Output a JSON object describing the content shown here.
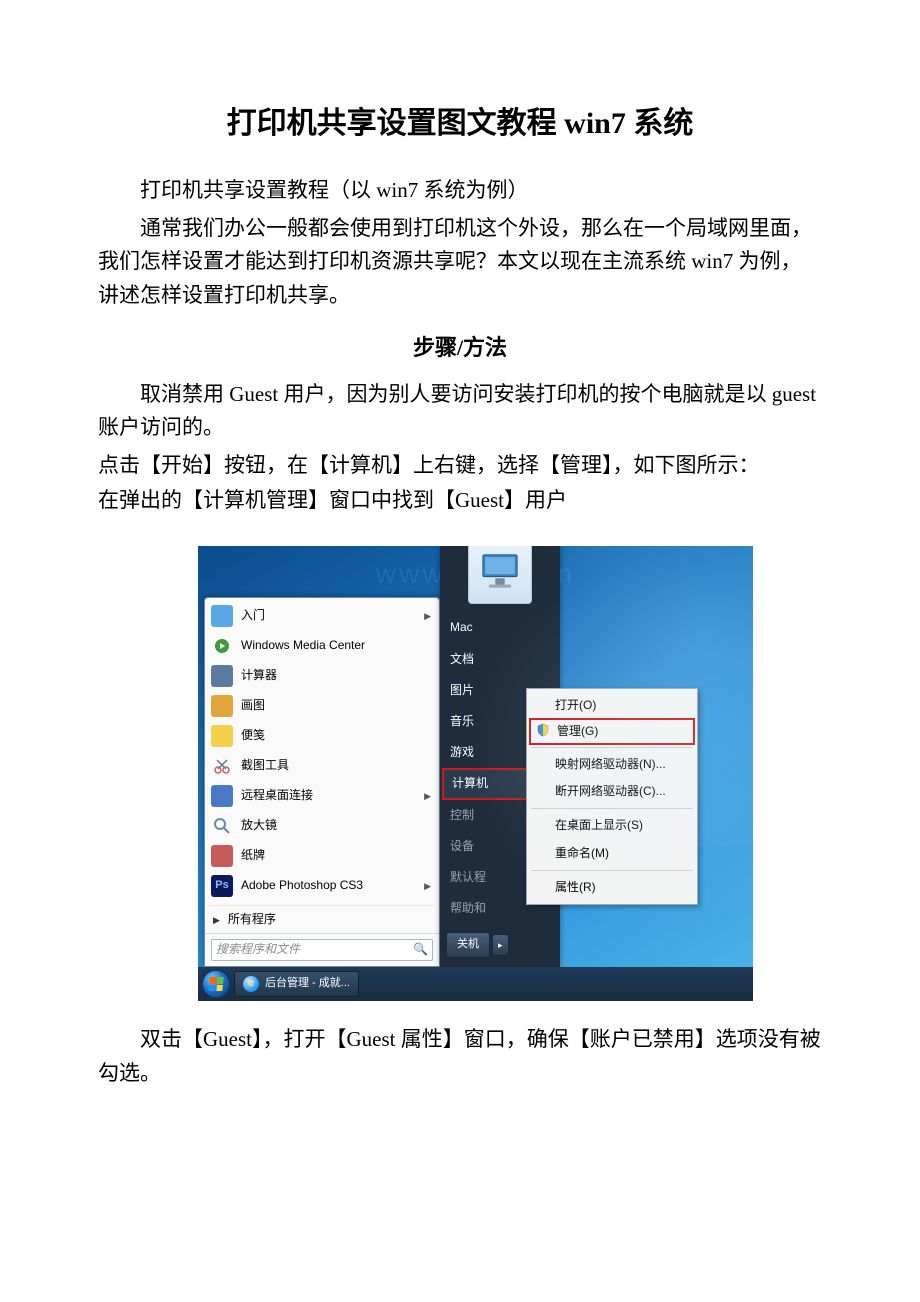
{
  "title": "打印机共享设置图文教程 win7 系统",
  "intro1": "打印机共享设置教程（以 win7 系统为例）",
  "intro2": "通常我们办公一般都会使用到打印机这个外设，那么在一个局域网里面，我们怎样设置才能达到打印机资源共享呢？本文以现在主流系统 win7 为例，讲述怎样设置打印机共享。",
  "steps_heading": "步骤/方法",
  "p1": "取消禁用 Guest 用户，因为别人要访问安装打印机的按个电脑就是以 guest 账户访问的。",
  "p2": "点击【开始】按钮，在【计算机】上右键，选择【管理】，如下图所示：",
  "p3": "在弹出的【计算机管理】窗口中找到【Guest】用户",
  "p4": "双击【Guest】，打开【Guest 属性】窗口，确保【账户已禁用】选项没有被勾选。",
  "watermark": "www.bo        .com",
  "start_left": [
    {
      "label": "入门",
      "icon": "getting-started-icon",
      "color": "#5aa7e8",
      "arrow": true
    },
    {
      "label": "Windows Media Center",
      "icon": "wmc-icon",
      "color": "#3e9a3e",
      "arrow": false
    },
    {
      "label": "计算器",
      "icon": "calculator-icon",
      "color": "#5a7aa0",
      "arrow": false
    },
    {
      "label": "画图",
      "icon": "paint-icon",
      "color": "#e0a63a",
      "arrow": false
    },
    {
      "label": "便笺",
      "icon": "sticky-notes-icon",
      "color": "#f4cf4a",
      "arrow": false
    },
    {
      "label": "截图工具",
      "icon": "snipping-icon",
      "color": "#d85a5a",
      "arrow": false
    },
    {
      "label": "远程桌面连接",
      "icon": "rdp-icon",
      "color": "#4a78c8",
      "arrow": true
    },
    {
      "label": "放大镜",
      "icon": "magnifier-icon",
      "color": "#6a8aa8",
      "arrow": false
    },
    {
      "label": "纸牌",
      "icon": "solitaire-icon",
      "color": "#c85a5a",
      "arrow": false
    },
    {
      "label": "Adobe Photoshop CS3",
      "icon": "ps-icon",
      "color": "#0a1a5c",
      "arrow": true
    }
  ],
  "all_programs": "所有程序",
  "search_placeholder": "搜索程序和文件",
  "start_right": {
    "items": [
      "Mac",
      "文档",
      "图片",
      "音乐",
      "游戏"
    ],
    "hi": "计算机",
    "tail": [
      "控制",
      "设备",
      "默认程",
      "帮助和"
    ]
  },
  "shutdown": "关机",
  "context_menu": {
    "open": "打开(O)",
    "manage": "管理(G)",
    "map": "映射网络驱动器(N)...",
    "disc": "断开网络驱动器(C)...",
    "show": "在桌面上显示(S)",
    "rename": "重命名(M)",
    "props": "属性(R)"
  },
  "taskbar_item": "后台管理 - 成就..."
}
